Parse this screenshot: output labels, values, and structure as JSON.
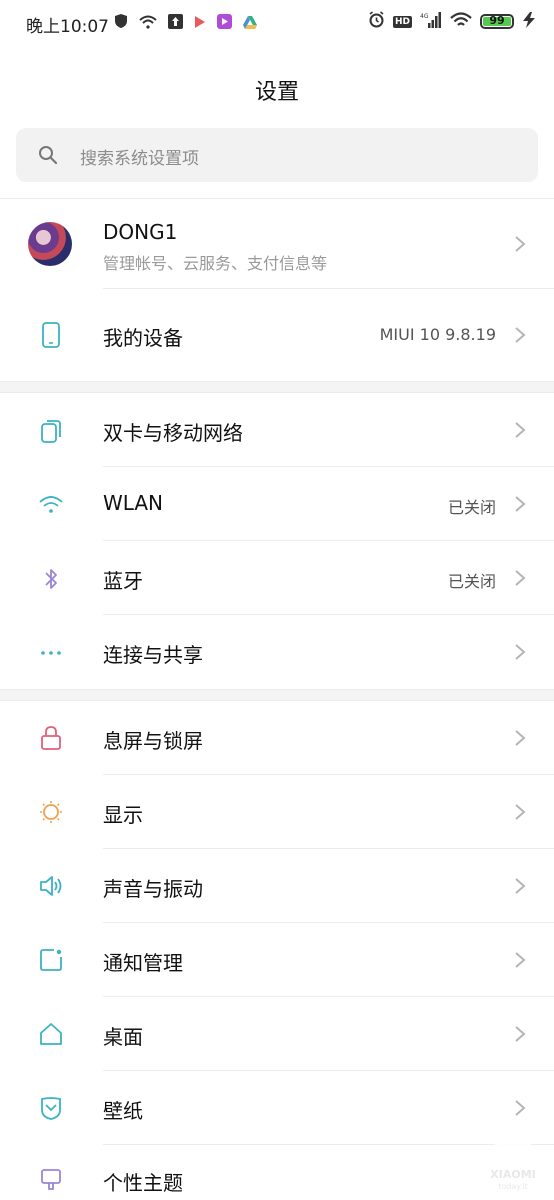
{
  "status_bar": {
    "time": "晚上10:07",
    "battery": "99",
    "network": "4G"
  },
  "header": {
    "title": "设置"
  },
  "search": {
    "placeholder": "搜索系统设置项"
  },
  "account": {
    "name": "DONG1",
    "subtitle": "管理帐号、云服务、支付信息等"
  },
  "my_device": {
    "label": "我的设备",
    "value": "MIUI 10 9.8.19"
  },
  "network_section": [
    {
      "label": "双卡与移动网络",
      "value": "",
      "icon": "dual-sim-icon"
    },
    {
      "label": "WLAN",
      "value": "已关闭",
      "icon": "wifi-icon"
    },
    {
      "label": "蓝牙",
      "value": "已关闭",
      "icon": "bluetooth-icon"
    },
    {
      "label": "连接与共享",
      "value": "",
      "icon": "more-dots-icon"
    }
  ],
  "display_section": [
    {
      "label": "息屏与锁屏",
      "icon": "lock-icon"
    },
    {
      "label": "显示",
      "icon": "sun-icon"
    },
    {
      "label": "声音与振动",
      "icon": "speaker-icon"
    },
    {
      "label": "通知管理",
      "icon": "notification-icon"
    },
    {
      "label": "桌面",
      "icon": "home-icon"
    },
    {
      "label": "壁纸",
      "icon": "wallpaper-icon"
    },
    {
      "label": "个性主题",
      "icon": "theme-icon"
    }
  ],
  "watermark": {
    "brand": "XIAOMI",
    "site": "today.it"
  },
  "colors": {
    "teal": "#3bb3c3",
    "pink": "#e0607a",
    "orange": "#f0a04b",
    "purple": "#9b86d6",
    "battery_green": "#56c94f"
  }
}
